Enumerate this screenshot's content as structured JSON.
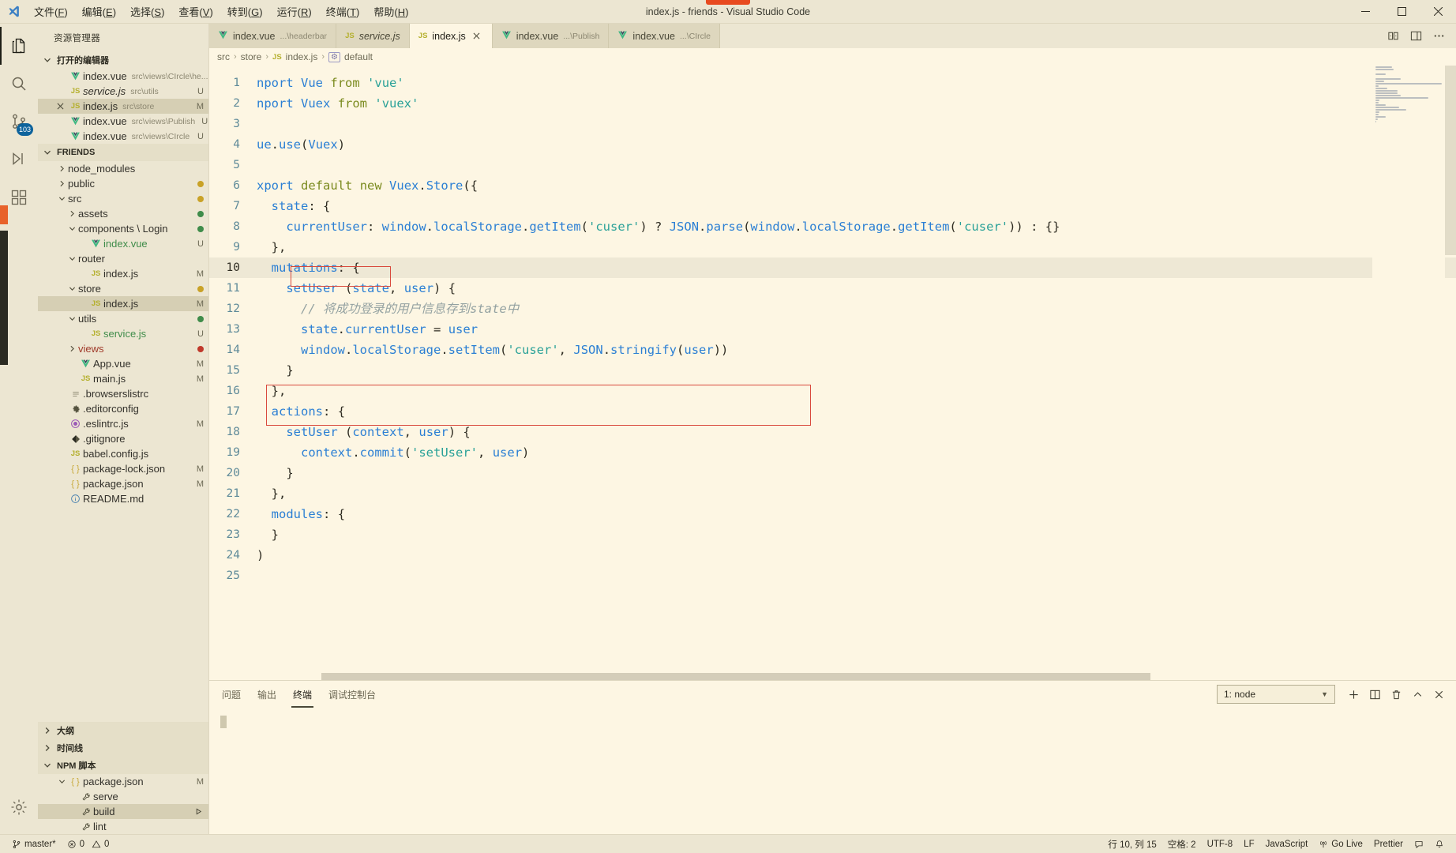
{
  "titlebar": {
    "window_title": "index.js - friends - Visual Studio Code",
    "logo_icon": "vscode-logo-icon",
    "menus": [
      {
        "label": "文件",
        "mnemonic": "F"
      },
      {
        "label": "编辑",
        "mnemonic": "E"
      },
      {
        "label": "选择",
        "mnemonic": "S"
      },
      {
        "label": "查看",
        "mnemonic": "V"
      },
      {
        "label": "转到",
        "mnemonic": "G"
      },
      {
        "label": "运行",
        "mnemonic": "R"
      },
      {
        "label": "终端",
        "mnemonic": "T"
      },
      {
        "label": "帮助",
        "mnemonic": "H"
      }
    ],
    "controls": {
      "minimize": "minimize-icon",
      "maximize": "maximize-icon",
      "close": "close-icon"
    }
  },
  "activitybar": {
    "items": [
      {
        "name": "explorer",
        "icon": "files-icon",
        "active": true,
        "badge": ""
      },
      {
        "name": "search",
        "icon": "search-icon",
        "active": false,
        "badge": ""
      },
      {
        "name": "source-control",
        "icon": "source-control-icon",
        "active": false,
        "badge": "103"
      },
      {
        "name": "run-and-debug",
        "icon": "run-debug-icon",
        "active": false,
        "badge": ""
      },
      {
        "name": "extensions",
        "icon": "extensions-icon",
        "active": false,
        "badge": ""
      }
    ],
    "bottom": [
      {
        "name": "manage",
        "icon": "gear-icon"
      }
    ]
  },
  "sidebar": {
    "title": "资源管理器",
    "open_editors": {
      "label": "打开的编辑器",
      "expanded": true,
      "items": [
        {
          "name": "index.vue",
          "path": "src\\views\\CIrcle\\he...",
          "icon": "vue-icon",
          "status": "U",
          "selected": false,
          "close": false
        },
        {
          "name": "service.js",
          "path": "src\\utils",
          "icon": "js-icon",
          "status": "U",
          "selected": false,
          "close": false,
          "italic": true
        },
        {
          "name": "index.js",
          "path": "src\\store",
          "icon": "js-icon",
          "status": "M",
          "selected": true,
          "close": true
        },
        {
          "name": "index.vue",
          "path": "src\\views\\Publish",
          "icon": "vue-icon",
          "status": "U",
          "selected": false,
          "close": false
        },
        {
          "name": "index.vue",
          "path": "src\\views\\CIrcle",
          "icon": "vue-icon",
          "status": "U",
          "selected": false,
          "close": false
        }
      ]
    },
    "project": {
      "label": "FRIENDS",
      "expanded": true,
      "tree": [
        {
          "name": "node_modules",
          "indent": 1,
          "type": "folder",
          "expanded": false,
          "status": "",
          "icon": ""
        },
        {
          "name": "public",
          "indent": 1,
          "type": "folder",
          "expanded": false,
          "status": "",
          "icon": "",
          "dot": "#c9a227"
        },
        {
          "name": "src",
          "indent": 1,
          "type": "folder",
          "expanded": true,
          "status": "",
          "icon": "",
          "dot": "#c9a227"
        },
        {
          "name": "assets",
          "indent": 2,
          "type": "folder",
          "expanded": false,
          "status": "",
          "icon": "",
          "dot": "#3f8c4a"
        },
        {
          "name": "components \\ Login",
          "indent": 2,
          "type": "folder",
          "expanded": true,
          "status": "",
          "icon": "",
          "dot": "#3f8c4a"
        },
        {
          "name": "index.vue",
          "indent": 3,
          "type": "file",
          "icon": "vue-icon",
          "status": "U",
          "color": "#3f8c4a"
        },
        {
          "name": "router",
          "indent": 2,
          "type": "folder",
          "expanded": true,
          "status": "",
          "icon": ""
        },
        {
          "name": "index.js",
          "indent": 3,
          "type": "file",
          "icon": "js-icon",
          "status": "M"
        },
        {
          "name": "store",
          "indent": 2,
          "type": "folder",
          "expanded": true,
          "status": "",
          "icon": "",
          "dot": "#c9a227"
        },
        {
          "name": "index.js",
          "indent": 3,
          "type": "file",
          "icon": "js-icon",
          "status": "M",
          "selected": true
        },
        {
          "name": "utils",
          "indent": 2,
          "type": "folder",
          "expanded": true,
          "status": "",
          "icon": "",
          "dot": "#3f8c4a"
        },
        {
          "name": "service.js",
          "indent": 3,
          "type": "file",
          "icon": "js-icon",
          "status": "U",
          "color": "#3f8c4a"
        },
        {
          "name": "views",
          "indent": 2,
          "type": "folder",
          "expanded": false,
          "status": "",
          "icon": "",
          "dot": "#c0392b",
          "color": "#a03a2a"
        },
        {
          "name": "App.vue",
          "indent": 2,
          "type": "file",
          "icon": "vue-icon",
          "status": "M"
        },
        {
          "name": "main.js",
          "indent": 2,
          "type": "file",
          "icon": "js-icon",
          "status": "M"
        },
        {
          "name": ".browserslistrc",
          "indent": 1,
          "type": "file",
          "icon": "lines-icon",
          "status": ""
        },
        {
          "name": ".editorconfig",
          "indent": 1,
          "type": "file",
          "icon": "gear-icon",
          "status": ""
        },
        {
          "name": ".eslintrc.js",
          "indent": 1,
          "type": "file",
          "icon": "eslint-icon",
          "status": "M"
        },
        {
          "name": ".gitignore",
          "indent": 1,
          "type": "file",
          "icon": "git-icon",
          "status": ""
        },
        {
          "name": "babel.config.js",
          "indent": 1,
          "type": "file",
          "icon": "js-icon",
          "status": ""
        },
        {
          "name": "package-lock.json",
          "indent": 1,
          "type": "file",
          "icon": "json-icon",
          "status": "M"
        },
        {
          "name": "package.json",
          "indent": 1,
          "type": "file",
          "icon": "json-icon",
          "status": "M"
        },
        {
          "name": "README.md",
          "indent": 1,
          "type": "file",
          "icon": "info-icon",
          "status": ""
        }
      ]
    },
    "panels": [
      {
        "label": "大纲",
        "expanded": false
      },
      {
        "label": "时间线",
        "expanded": false
      },
      {
        "label": "NPM 脚本",
        "expanded": true
      }
    ],
    "npm_scripts": [
      {
        "name": "package.json",
        "indent": 1,
        "icon": "json-icon",
        "status": "M",
        "expanded": true,
        "type": "folder"
      },
      {
        "name": "serve",
        "indent": 2,
        "icon": "wrench-icon",
        "status": "",
        "type": "script"
      },
      {
        "name": "build",
        "indent": 2,
        "icon": "wrench-icon",
        "status": "",
        "type": "script",
        "selected": true,
        "run": true
      },
      {
        "name": "lint",
        "indent": 2,
        "icon": "wrench-icon",
        "status": "",
        "type": "script"
      }
    ]
  },
  "editor": {
    "tabs": [
      {
        "name": "index.vue",
        "path": "...\\headerbar",
        "icon": "vue-icon",
        "active": false,
        "italic": false,
        "close": false
      },
      {
        "name": "service.js",
        "path": "",
        "icon": "js-icon",
        "active": false,
        "italic": true,
        "close": false
      },
      {
        "name": "index.js",
        "path": "",
        "icon": "js-icon",
        "active": true,
        "italic": false,
        "close": true
      },
      {
        "name": "index.vue",
        "path": "...\\Publish",
        "icon": "vue-icon",
        "active": false,
        "italic": false,
        "close": false
      },
      {
        "name": "index.vue",
        "path": "...\\CIrcle",
        "icon": "vue-icon",
        "active": false,
        "italic": false,
        "close": false
      }
    ],
    "tab_actions": [
      {
        "name": "split-editor-icon"
      },
      {
        "name": "layout-icon"
      },
      {
        "name": "more-actions-icon"
      }
    ],
    "breadcrumb": [
      "src",
      "store",
      "index.js",
      "default"
    ],
    "lines": [
      {
        "n": 1,
        "text": "nport Vue from 'vue'"
      },
      {
        "n": 2,
        "text": "nport Vuex from 'vuex'"
      },
      {
        "n": 3,
        "text": ""
      },
      {
        "n": 4,
        "text": "ue.use(Vuex)"
      },
      {
        "n": 5,
        "text": ""
      },
      {
        "n": 6,
        "text": "xport default new Vuex.Store({"
      },
      {
        "n": 7,
        "text": "  state: {"
      },
      {
        "n": 8,
        "text": "    currentUser: window.localStorage.getItem('cuser') ? JSON.parse(window.localStorage.getItem('cuser')) : {}"
      },
      {
        "n": 9,
        "text": "  },"
      },
      {
        "n": 10,
        "text": "  mutations: {"
      },
      {
        "n": 11,
        "text": "    setUser (state, user) {"
      },
      {
        "n": 12,
        "text": "      // 将成功登录的用户信息存到state中"
      },
      {
        "n": 13,
        "text": "      state.currentUser = user"
      },
      {
        "n": 14,
        "text": "      window.localStorage.setItem('cuser', JSON.stringify(user))"
      },
      {
        "n": 15,
        "text": "    }"
      },
      {
        "n": 16,
        "text": "  },"
      },
      {
        "n": 17,
        "text": "  actions: {"
      },
      {
        "n": 18,
        "text": "    setUser (context, user) {"
      },
      {
        "n": 19,
        "text": "      context.commit('setUser', user)"
      },
      {
        "n": 20,
        "text": "    }"
      },
      {
        "n": 21,
        "text": "  },"
      },
      {
        "n": 22,
        "text": "  modules: {"
      },
      {
        "n": 23,
        "text": "  }"
      },
      {
        "n": 24,
        "text": ")"
      },
      {
        "n": 25,
        "text": ""
      }
    ],
    "current_line": 10,
    "annotations": [
      {
        "name": "red-box-currentUser",
        "line": 8,
        "label": "currentUser:"
      },
      {
        "name": "red-box-setItem",
        "lines": "14-15",
        "label": "window.localStorage.setItem('cuser', JSON.stringify(user))"
      }
    ]
  },
  "panel": {
    "tabs": [
      {
        "label": "问题",
        "active": false
      },
      {
        "label": "输出",
        "active": false
      },
      {
        "label": "终端",
        "active": true
      },
      {
        "label": "调试控制台",
        "active": false
      }
    ],
    "terminal_select": "1: node",
    "actions": [
      {
        "name": "new-terminal-icon"
      },
      {
        "name": "split-terminal-icon"
      },
      {
        "name": "kill-terminal-icon"
      },
      {
        "name": "maximize-panel-icon"
      },
      {
        "name": "close-panel-icon"
      }
    ],
    "content": ""
  },
  "statusbar": {
    "left": [
      {
        "name": "remote-indicator",
        "label": "",
        "icon": "remote-icon"
      },
      {
        "name": "branch",
        "label": "master*",
        "icon": "git-branch-icon"
      },
      {
        "name": "errors",
        "label": "0",
        "icon": "error-icon"
      },
      {
        "name": "warnings",
        "label": "0",
        "icon": "warning-icon"
      }
    ],
    "right": [
      {
        "name": "cursor-position",
        "label": "行 10, 列 15",
        "icon": ""
      },
      {
        "name": "indentation",
        "label": "空格: 2",
        "icon": ""
      },
      {
        "name": "encoding",
        "label": "UTF-8",
        "icon": ""
      },
      {
        "name": "eol",
        "label": "LF",
        "icon": ""
      },
      {
        "name": "language-mode",
        "label": "JavaScript",
        "icon": ""
      },
      {
        "name": "go-live",
        "label": "Go Live",
        "icon": "broadcast-icon"
      },
      {
        "name": "prettier",
        "label": "Prettier",
        "icon": ""
      },
      {
        "name": "feedback",
        "label": "",
        "icon": "feedback-icon"
      },
      {
        "name": "notifications",
        "label": "",
        "icon": "bell-icon"
      }
    ]
  },
  "colors": {
    "background": "#ece6d2",
    "editor_background": "#fdf6e3",
    "accent_red": "#d94a3d",
    "title_accent": "#e84a1f",
    "keyword": "#7a8a1e",
    "identifier": "#2b7fd4",
    "string": "#2aa198",
    "comment": "#93a1a1"
  }
}
